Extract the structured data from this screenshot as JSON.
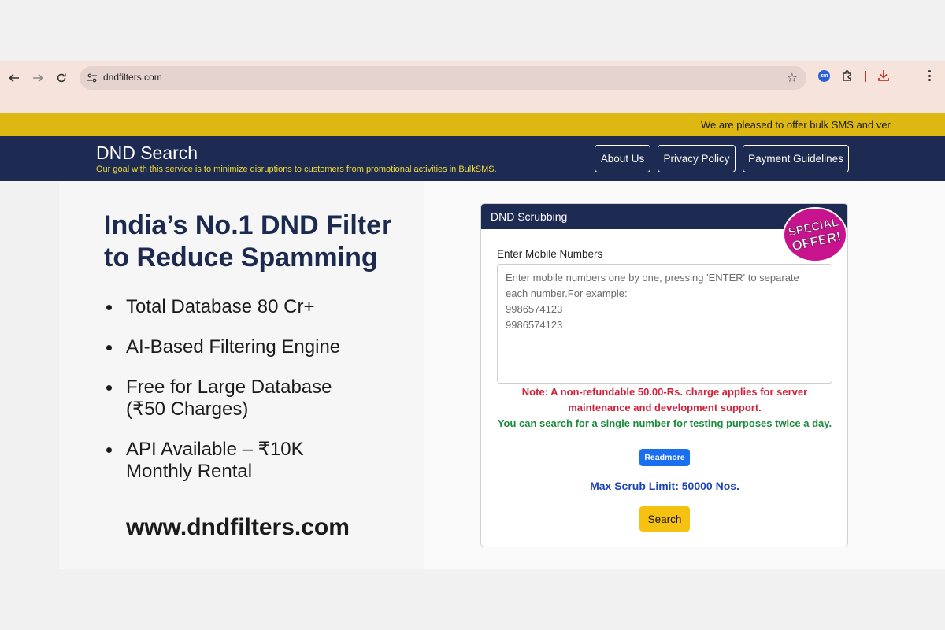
{
  "browser": {
    "url": "dndfilters.com",
    "extension_zm_label": "zm",
    "icons": [
      "back-arrow-icon",
      "forward-arrow-icon",
      "reload-icon",
      "site-settings-icon",
      "bookmark-star-icon",
      "zm-extension-icon",
      "puzzle-extension-icon",
      "download-icon",
      "kebab-menu-icon"
    ]
  },
  "marquee": {
    "text": "We are pleased to offer bulk SMS and ver"
  },
  "header": {
    "title": "DND Search",
    "tagline": "Our goal with this service is to minimize disruptions to customers from promotional activities in BulkSMS.",
    "nav": [
      {
        "label": "About Us"
      },
      {
        "label": "Privacy Policy"
      },
      {
        "label": "Payment Guidelines"
      }
    ]
  },
  "promo": {
    "headline": "India’s No.1 DND Filter to Reduce Spamming",
    "features": [
      {
        "line1": "Total Database 80 Cr+",
        "line2": ""
      },
      {
        "line1": "AI-Based Filtering Engine",
        "line2": ""
      },
      {
        "line1": "Free for Large Database",
        "line2": "(₹50 Charges)"
      },
      {
        "line1": "API Available – ₹10K",
        "line2": "Monthly Rental"
      }
    ],
    "website": "www.dndfilters.com"
  },
  "card": {
    "title": "DND Scrubbing",
    "badge_line1": "SPECIAL",
    "badge_line2": "OFFER!",
    "field_label": "Enter Mobile Numbers",
    "placeholder": "Enter mobile numbers one by one, pressing 'ENTER' to separate each number.For example:\n9986574123\n9986574123",
    "note_red": "Note: A non-refundable 50.00-Rs. charge applies for server maintenance and development support.",
    "note_green": "You can search for a single number for testing purposes twice a day.",
    "readmore_label": "Readmore",
    "max_limit": "Max Scrub Limit: 50000 Nos.",
    "search_label": "Search"
  },
  "colors": {
    "navy": "#1d2a52",
    "marquee_yellow": "#ddb812",
    "tagline_yellow": "#f1dd36",
    "note_red": "#d4213a",
    "note_green": "#1c8a3c",
    "limit_blue": "#1f45b5",
    "readmore_blue": "#1a6ff0",
    "search_yellow": "#f5c211",
    "badge_magenta": "#c8138f"
  }
}
